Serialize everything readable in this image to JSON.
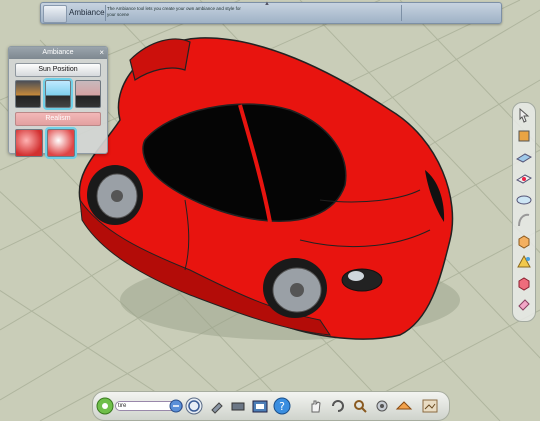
{
  "banner": {
    "tool_name": "Ambiance",
    "description": "The Ambiance tool lets you create your own ambiance and style for your scene"
  },
  "ambiance_panel": {
    "title": "Ambiance",
    "close_glyph": "×",
    "sun_position_label": "Sun Position",
    "realism_label": "Realism",
    "sun_presets": [
      "sunset",
      "midday",
      "dusk"
    ],
    "selected_sun_preset": "midday",
    "realism_presets": [
      "shaded",
      "realistic"
    ],
    "selected_realism_preset": "realistic"
  },
  "bottom_toolbar": {
    "search_value": "tire"
  },
  "colors": {
    "ground": "#c9cdb8",
    "grid": "#adb39c",
    "car_body": "#e8140f",
    "car_shadow": "#b30c08",
    "glass": "#050505"
  },
  "right_tools": [
    "select-icon",
    "paint-icon",
    "plane-icon",
    "stamp-icon",
    "ellipse-icon",
    "curve-icon",
    "box-icon",
    "pyramid-icon",
    "cube-icon",
    "eraser-icon"
  ],
  "bottom_tools": [
    "home-icon",
    "search-go-icon",
    "spiral-icon",
    "tools-icon",
    "car-parts-icon",
    "camera-icon",
    "help-icon",
    "hand-icon",
    "rotate-icon",
    "zoom-icon",
    "gear-icon",
    "ambiance-icon",
    "frame-icon"
  ]
}
